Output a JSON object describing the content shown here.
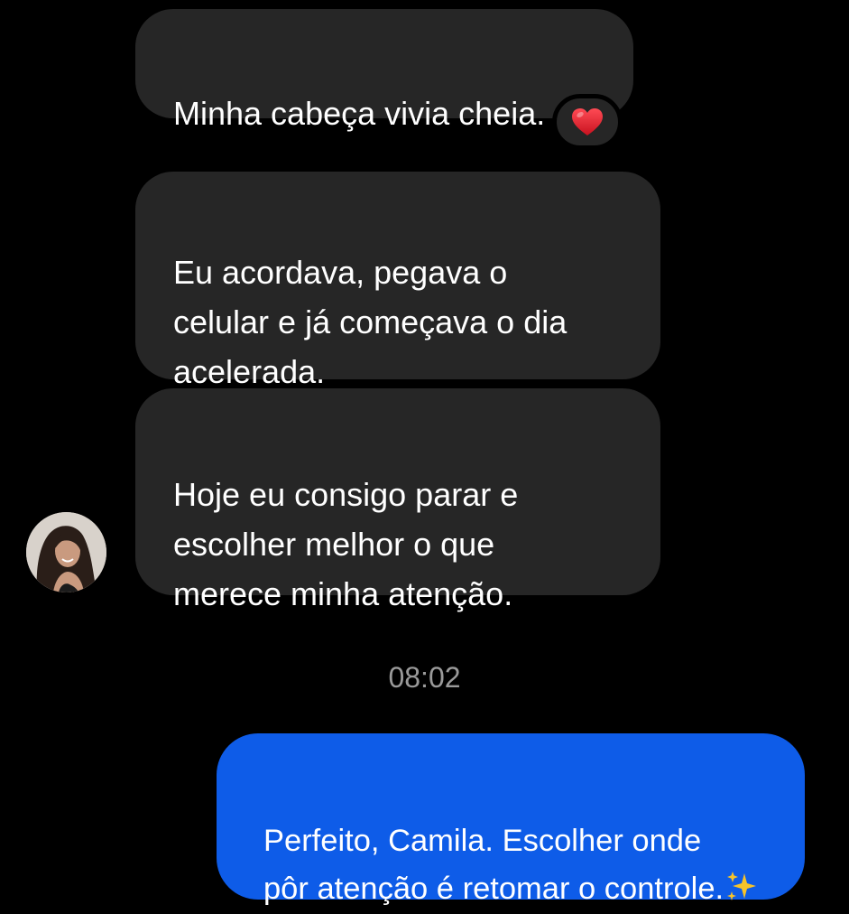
{
  "messages": {
    "incoming": [
      {
        "text": "Minha cabeça vivia cheia.",
        "reaction": "heart-emoji"
      },
      {
        "text": "Eu acordava, pegava o\ncelular e já começava o dia\nacelerada."
      },
      {
        "text": "Hoje eu consigo parar e\nescolher melhor o que\nmerece minha atenção."
      }
    ],
    "timestamp": "08:02",
    "outgoing": [
      {
        "text": "Perfeito, Camila. Escolher onde\npôr atenção é retomar o controle.",
        "emoji": "sparkles-emoji"
      }
    ]
  },
  "colors": {
    "background": "#000000",
    "incoming_bubble": "#262626",
    "outgoing_bubble": "#0e5ce8",
    "timestamp": "#9a9a9a",
    "heart": "#e0202e",
    "sparkles": "#f6c32a"
  }
}
